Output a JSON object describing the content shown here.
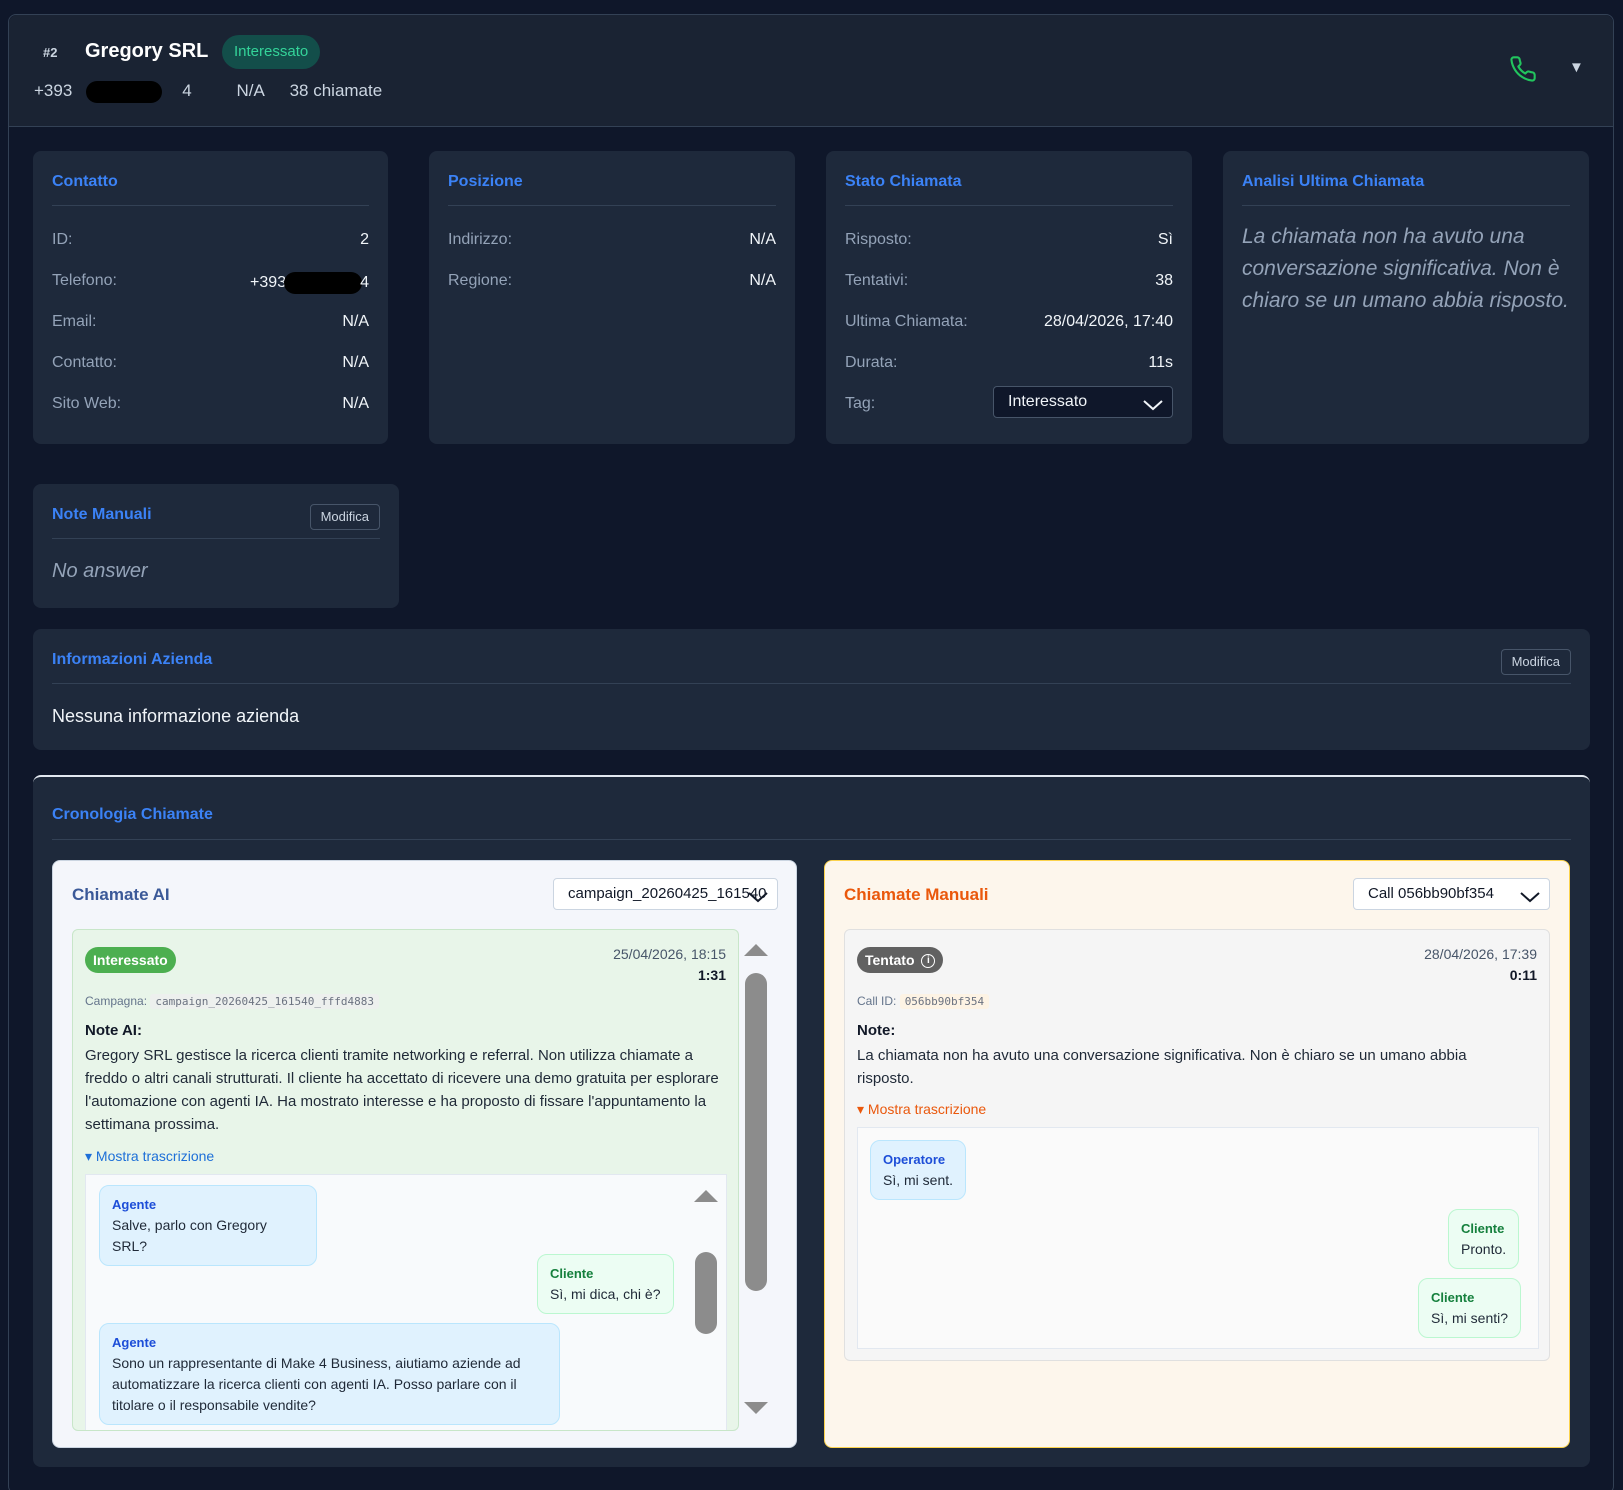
{
  "header": {
    "hash": "#2",
    "company": "Gregory SRL",
    "status_badge": "Interessato",
    "phone_prefix": "+393",
    "phone_suffix": "4",
    "location": "N/A",
    "calls_count": "38 chiamate"
  },
  "contact": {
    "title": "Contatto",
    "rows": [
      {
        "label": "ID:",
        "value": "2"
      },
      {
        "label": "Telefono:",
        "value_prefix": "+393",
        "value_suffix": "4"
      },
      {
        "label": "Email:",
        "value": "N/A"
      },
      {
        "label": "Contatto:",
        "value": "N/A"
      },
      {
        "label": "Sito Web:",
        "value": "N/A"
      }
    ]
  },
  "position": {
    "title": "Posizione",
    "rows": [
      {
        "label": "Indirizzo:",
        "value": "N/A"
      },
      {
        "label": "Regione:",
        "value": "N/A"
      }
    ]
  },
  "call_state": {
    "title": "Stato Chiamata",
    "rows": [
      {
        "label": "Risposto:",
        "value": "Sì"
      },
      {
        "label": "Tentativi:",
        "value": "38"
      },
      {
        "label": "Ultima Chiamata:",
        "value": "28/04/2026, 17:40"
      },
      {
        "label": "Durata:",
        "value": "11s"
      },
      {
        "label": "Tag:",
        "value": "Interessato"
      }
    ]
  },
  "analysis": {
    "title": "Analisi Ultima Chiamata",
    "text": "La chiamata non ha avuto una conversazione significativa. Non è chiaro se un umano abbia risposto."
  },
  "notes": {
    "title": "Note Manuali",
    "edit_label": "Modifica",
    "text": "No answer"
  },
  "company_info": {
    "title": "Informazioni Azienda",
    "edit_label": "Modifica",
    "text": "Nessuna informazione azienda"
  },
  "history": {
    "title": "Cronologia Chiamate",
    "ai": {
      "title": "Chiamate AI",
      "selected": "campaign_20260425_161540",
      "status": "Interessato",
      "datetime": "25/04/2026, 18:15",
      "duration": "1:31",
      "campaign_label": "Campagna:",
      "campaign_id": "campaign_20260425_161540_fffd4883",
      "note_heading": "Note AI:",
      "note": "Gregory SRL gestisce la ricerca clienti tramite networking e referral. Non utilizza chiamate a freddo o altri canali strutturati. Il cliente ha accettato di ricevere una demo gratuita per esplorare l'automazione con agenti IA. Ha mostrato interesse e ha proposto di fissare l'appuntamento la settimana prossima.",
      "toggle": "▾ Mostra trascrizione",
      "transcript": [
        {
          "speaker": "Agente",
          "text": "Salve, parlo con Gregory SRL?"
        },
        {
          "speaker": "Cliente",
          "text": "Sì, mi dica, chi è?"
        },
        {
          "speaker": "Agente",
          "text": "Sono un rappresentante di Make 4 Business, aiutiamo aziende ad automatizzare la ricerca clienti con agenti IA. Posso parlare con il titolare o il responsabile vendite?"
        }
      ]
    },
    "manual": {
      "title": "Chiamate Manuali",
      "selected": "Call 056bb90bf354",
      "status": "Tentato",
      "datetime": "28/04/2026, 17:39",
      "duration": "0:11",
      "callid_label": "Call ID:",
      "call_id": "056bb90bf354",
      "note_heading": "Note:",
      "note": "La chiamata non ha avuto una conversazione significativa. Non è chiaro se un umano abbia risposto.",
      "toggle": "▾ Mostra trascrizione",
      "transcript": [
        {
          "speaker": "Operatore",
          "text": "Sì, mi sent."
        },
        {
          "speaker": "Cliente",
          "text": "Pronto."
        },
        {
          "speaker": "Cliente",
          "text": "Sì, mi senti?"
        }
      ]
    }
  },
  "colors": {
    "accent": "#3b82f6",
    "success": "#34d399",
    "manual_accent": "#ea580c"
  }
}
